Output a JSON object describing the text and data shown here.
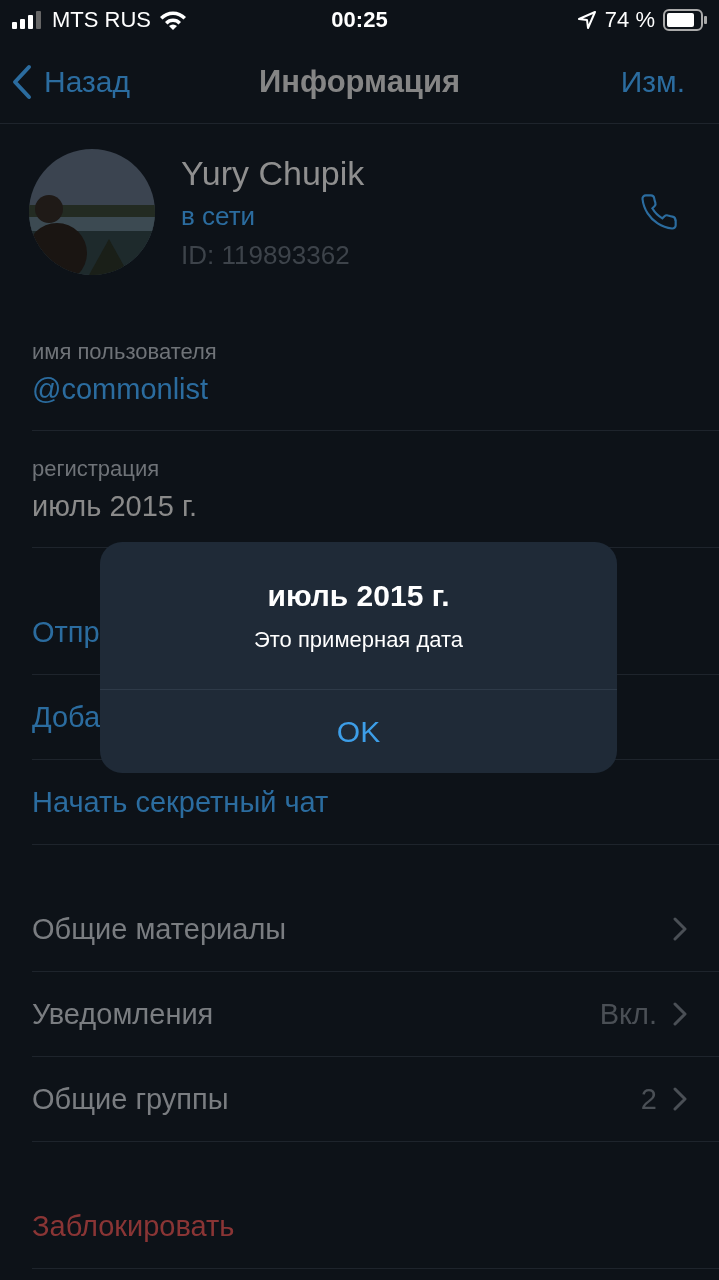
{
  "status_bar": {
    "carrier": "MTS RUS",
    "time": "00:25",
    "battery": "74 %"
  },
  "nav": {
    "back": "Назад",
    "title": "Информация",
    "edit": "Изм."
  },
  "profile": {
    "name": "Yury Chupik",
    "status": "в сети",
    "id": "ID: 119893362"
  },
  "info": [
    {
      "label": "имя пользователя",
      "value": "@commonlist",
      "kind": "link"
    },
    {
      "label": "регистрация",
      "value": "июль 2015 г.",
      "kind": "plain"
    }
  ],
  "actions": [
    "Отпр",
    "Доба",
    "Начать секретный чат"
  ],
  "settings": [
    {
      "label": "Общие материалы"
    },
    {
      "label": "Уведомления",
      "value": "Вкл."
    },
    {
      "label": "Общие группы",
      "value": "2"
    }
  ],
  "danger": [
    "Заблокировать"
  ],
  "alert": {
    "title": "июль 2015 г.",
    "message": "Это примерная дата",
    "button": "OK"
  }
}
